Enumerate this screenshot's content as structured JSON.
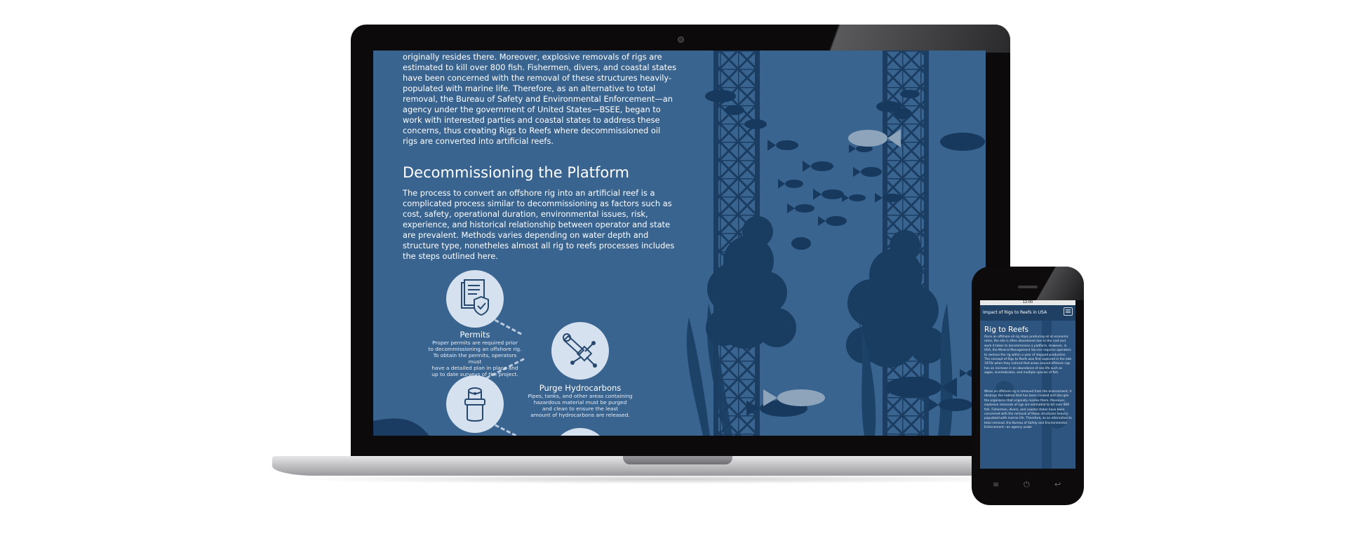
{
  "laptop_screen": {
    "intro_paragraph": "originally resides there. Moreover, explosive removals of rigs are estimated to kill over 800 fish. Fishermen, divers, and coastal states have been concerned with the removal of these structures heavily-populated with marine life. Therefore, as an alternative to total removal, the Bureau of Safety and Environmental Enforcement—an agency under the government of United States—BSEE, began to work with interested parties and coastal states to address these concerns, thus creating Rigs to Reefs where decommissioned oil rigs are converted into artificial reefs.",
    "section_heading": "Decommissioning the Platform",
    "section_paragraph": "The process to convert an offshore rig into an artificial reef is a complicated process similar to decommissioning as factors such as cost, safety, operational duration, environmental issues, risk, experience, and historical relationship between operator and state are prevalent. Methods varies depending on water depth and structure type, nonetheles almost all rig to reefs processes includes the steps outlined here.",
    "steps": [
      {
        "title": "Permits",
        "icon": "document-shield-icon",
        "lines": [
          "Proper permits are required prior",
          "to decommissioning an offshore rig.",
          "To obtain the permits, operators must",
          "have  a detailed plan in place and",
          "up to date surveys of the project."
        ]
      },
      {
        "title": "Purge Hydrocarbons",
        "icon": "pipe-wrench-icon",
        "lines": [
          "Pipes, tanks, and other areas containing",
          "hazardous material must be purged",
          "and clean to ensure the least",
          "amount of hydrocarbons are released."
        ]
      },
      {
        "title": "",
        "icon": "cylinder-plug-icon",
        "lines": []
      }
    ],
    "colors": {
      "background": "#3a6490",
      "silhouette": "#173a5e",
      "light_fish": "#8ea4bb",
      "step_circle": "#d5e1ee"
    }
  },
  "phone_screen": {
    "status_time": "12:00",
    "header_title": "Impact of Rigs to Reefs in USA",
    "menu_icon": "hamburger-menu-icon",
    "heading": "Rig to Reefs",
    "paragraph_1": "Once an offshore oil rig stops producing oil at economic rates, the site is often abandoned due to the cost and work it takes to decommission a platform. However, in USA, the Mineral Management Service requires operators to remove the rig within a year of stopped production. The concept of Rigs to Reefs was first explored in the late 1970s when they noticed that areas around offshore rigs has an increase in an abundance of sea life such as algae, invertebrates, and multiple species of fish.",
    "paragraph_2": "When an offshore rig is removed from the environment, it destroys the habitat that has been created and disrupts the organisms that originally resides there. Moreover, explosive removals of rigs are estimated to kill over 800 fish. Fishermen, divers, and coastal states have been concerned with the removal of these structures heavily-populated with marine life. Therefore, as an alternative to total removal, the Bureau of Safety and Environmental Enforcement—an agency under",
    "nav_buttons": [
      "menu-icon",
      "power-icon",
      "back-icon"
    ]
  }
}
